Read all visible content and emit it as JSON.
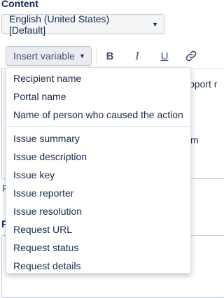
{
  "content": {
    "label": "Content",
    "language_select": {
      "value": "English (United States) [Default]"
    }
  },
  "toolbar": {
    "insert_variable_label": "Insert variable",
    "bold_label": "B",
    "italic_label": "I",
    "underline_label": "U"
  },
  "background_fragments": {
    "editor_text_1": "pport r",
    "editor_text_2": "m",
    "link_fragment": "F",
    "field_label_fragment": "F"
  },
  "variable_menu": {
    "group1": [
      "Recipient name",
      "Portal name",
      "Name of person who caused the action"
    ],
    "group2": [
      "Issue summary",
      "Issue description",
      "Issue key",
      "Issue reporter",
      "Issue resolution",
      "Request URL",
      "Request status",
      "Request details"
    ]
  },
  "colors": {
    "text": "#172b4d",
    "link": "#0052cc",
    "border": "#c1c7d0",
    "button_bg": "#ebecf0"
  },
  "icons": {
    "caret": "chevron-down-icon",
    "link": "link-icon"
  }
}
